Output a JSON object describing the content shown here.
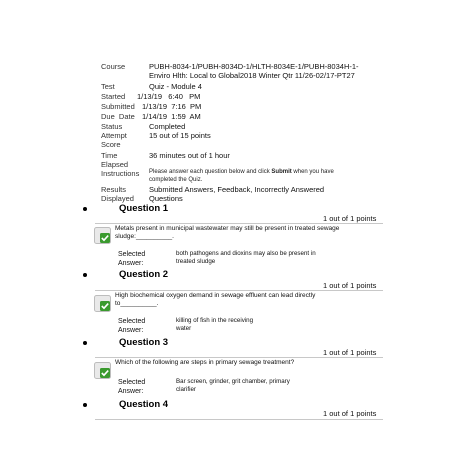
{
  "header": {
    "course_label": "Course",
    "course_value_line1": "PUBH-8034-1/PUBH-8034D-1/HLTH-8034E-1/PUBH-8034H-1-",
    "course_value_line2": "Enviro Hlth: Local to Global2018 Winter Qtr 11/26-02/17-PT27",
    "test_label": "Test",
    "test_value": "Quiz - Module 4",
    "started_label": "Started",
    "started_value": "1/13/19   6:40   PM",
    "submitted_label": "Submitted",
    "submitted_value": "1/13/19  7:16  PM",
    "due_label": "Due  Date",
    "due_value": "1/14/19  1:59  AM",
    "status_label": "Status",
    "status_value": "Completed",
    "attempt_label_line1": "Attempt",
    "attempt_label_line2": "Score",
    "attempt_value": "15 out of 15 points",
    "time_label_line1": "Time",
    "time_label_line2": "Elapsed",
    "time_value": "36 minutes out of 1 hour",
    "instructions_label": "Instructions",
    "instructions_before": "Please answer each question below and click ",
    "instructions_bold": "Submit",
    "instructions_after": " when you have",
    "instructions_line2": "completed the Quiz.",
    "results_label_line1": "Results",
    "results_label_line2": "Displayed",
    "results_value_line1": "Submitted Answers, Feedback, Incorrectly Answered",
    "results_value_line2": "Questions"
  },
  "questions": [
    {
      "title": "Question 1",
      "points": "1 out of 1 points",
      "text_line1": "Metals present in municipal wastewater may still be present in treated sewage",
      "text_line2": "sludge:__________.",
      "selected_label_line1": "Selected",
      "selected_label_line2": "Answer:",
      "answer_line1": "both pathogens and dioxins may also be present in",
      "answer_line2": "treated sludge"
    },
    {
      "title": "Question 2",
      "points": "1 out of 1 points",
      "text_line1": "High biochemical oxygen demand in sewage effluent can lead directly",
      "text_line2": "to__________.",
      "selected_label_line1": "Selected",
      "selected_label_line2": "Answer:",
      "answer_line1": "killing of fish in the receiving",
      "answer_line2": "water"
    },
    {
      "title": "Question 3",
      "points": "1 out of 1 points",
      "text_line1": "Which of the following are steps in primary sewage treatment?",
      "text_line2": "",
      "selected_label_line1": "Selected",
      "selected_label_line2": "Answer:",
      "answer_line1": "Bar screen, grinder, grit chamber, primary",
      "answer_line2": "clarifier"
    },
    {
      "title": "Question 4",
      "points": "1 out of 1 points"
    }
  ],
  "colors": {
    "check_green": "#3a9a2e",
    "divider": "#c8c8c8",
    "icon_bg": "#e9e9e9"
  },
  "icons": {
    "correct": "correct-check-icon",
    "bullet": "bullet-icon"
  }
}
